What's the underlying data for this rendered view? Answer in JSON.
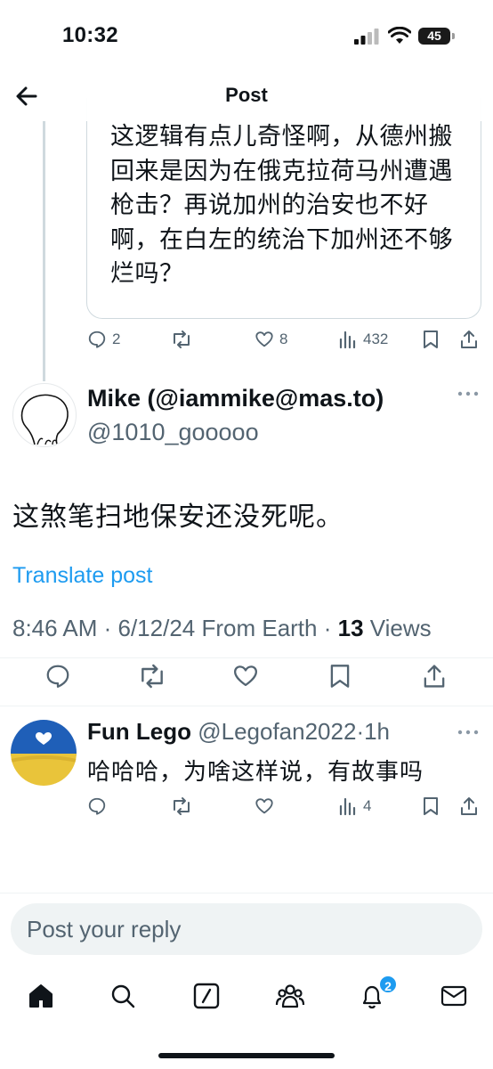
{
  "status_bar": {
    "time": "10:32",
    "battery": "45"
  },
  "header": {
    "title": "Post"
  },
  "parent_post": {
    "text": "这逻辑有点儿奇怪啊，从德州搬回来是因为在俄克拉荷马州遭遇枪击？再说加州的治安也不好啊，在白左的统治下加州还不够烂吗？",
    "replies": "2",
    "likes": "8",
    "views": "432"
  },
  "main_post": {
    "author_name": "Mike (@iammike@mas.to)",
    "handle": "@1010_gooooo",
    "text": "这煞笔扫地保安还没死呢。",
    "translate_label": "Translate post",
    "meta_prefix": "8:46 AM · 6/12/24 From Earth · ",
    "views_count": "13",
    "views_label": " Views"
  },
  "reply": {
    "author_name": "Fun Lego",
    "handle": "@Legofan2022",
    "time": "·1h",
    "text": "哈哈哈，为啥这样说，有故事吗",
    "views": "4"
  },
  "reply_input": {
    "placeholder": "Post your reply"
  },
  "tab_bar": {
    "notifications_badge": "2"
  },
  "colors": {
    "accent": "#1d9bf0",
    "secondary_text": "#536471",
    "border": "#cfd9de"
  }
}
